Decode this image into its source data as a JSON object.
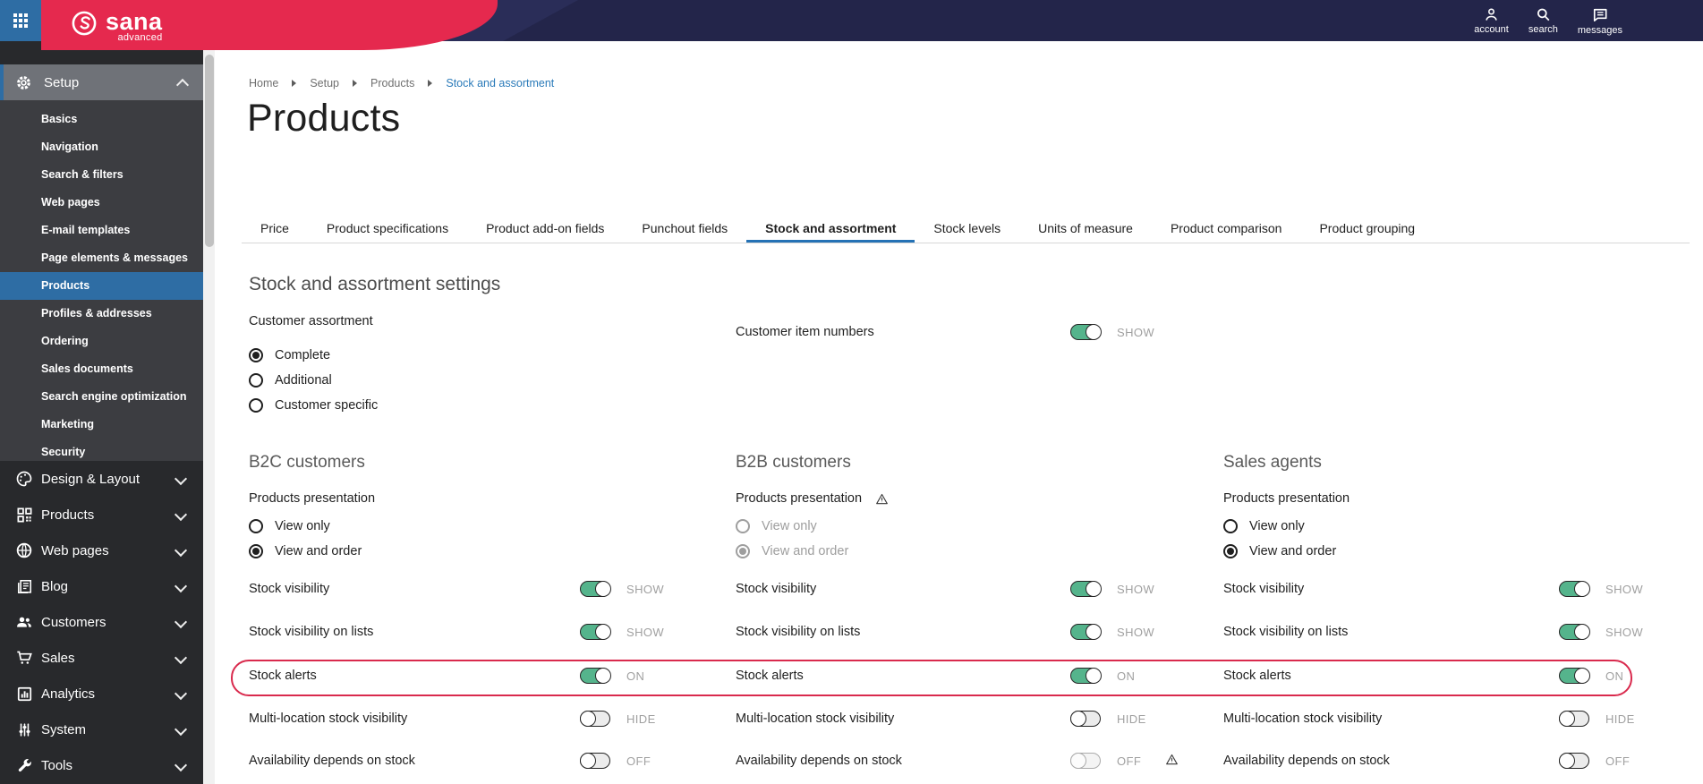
{
  "topbar": {
    "brand": "sana",
    "brand_sub": "advanced",
    "actions": [
      {
        "label": "account"
      },
      {
        "label": "search"
      },
      {
        "label": "messages"
      }
    ]
  },
  "sidebar": {
    "setup_label": "Setup",
    "setup_items": [
      "Basics",
      "Navigation",
      "Search & filters",
      "Web pages",
      "E-mail templates",
      "Page elements & messages",
      "Products",
      "Profiles & addresses",
      "Ordering",
      "Sales documents",
      "Search engine optimization",
      "Marketing",
      "Security"
    ],
    "active_item": "Products",
    "sections": [
      {
        "label": "Design & Layout"
      },
      {
        "label": "Products"
      },
      {
        "label": "Web pages"
      },
      {
        "label": "Blog"
      },
      {
        "label": "Customers"
      },
      {
        "label": "Sales"
      },
      {
        "label": "Analytics"
      },
      {
        "label": "System"
      },
      {
        "label": "Tools"
      }
    ]
  },
  "breadcrumb": {
    "items": [
      "Home",
      "Setup",
      "Products",
      "Stock and assortment"
    ]
  },
  "page": {
    "title": "Products"
  },
  "tabs": [
    "Price",
    "Product specifications",
    "Product add-on fields",
    "Punchout fields",
    "Stock and assortment",
    "Stock levels",
    "Units of measure",
    "Product comparison",
    "Product grouping"
  ],
  "active_tab": "Stock and assortment",
  "settings": {
    "heading": "Stock and assortment settings",
    "customer_assortment": {
      "label": "Customer assortment",
      "options": [
        "Complete",
        "Additional",
        "Customer specific"
      ],
      "selected": "Complete"
    },
    "customer_item_numbers": {
      "label": "Customer item numbers",
      "state": "SHOW"
    }
  },
  "columns": [
    {
      "heading": "B2C customers",
      "presentation": {
        "label": "Products presentation",
        "options": [
          "View only",
          "View and order"
        ],
        "selected": "View and order",
        "warning": false
      },
      "rows": [
        {
          "label": "Stock visibility",
          "state": "SHOW",
          "on": true
        },
        {
          "label": "Stock visibility on lists",
          "state": "SHOW",
          "on": true
        },
        {
          "label": "Stock alerts",
          "state": "ON",
          "on": true,
          "highlighted": true
        },
        {
          "label": "Multi-location stock visibility",
          "state": "HIDE",
          "on": false
        },
        {
          "label": "Availability depends on stock",
          "state": "OFF",
          "on": false
        }
      ]
    },
    {
      "heading": "B2B customers",
      "presentation": {
        "label": "Products presentation",
        "options": [
          "View only",
          "View and order"
        ],
        "selected": "View and order",
        "warning": true,
        "disabled": true
      },
      "rows": [
        {
          "label": "Stock visibility",
          "state": "SHOW",
          "on": true
        },
        {
          "label": "Stock visibility on lists",
          "state": "SHOW",
          "on": true
        },
        {
          "label": "Stock alerts",
          "state": "ON",
          "on": true,
          "highlighted": true
        },
        {
          "label": "Multi-location stock visibility",
          "state": "HIDE",
          "on": false
        },
        {
          "label": "Availability depends on stock",
          "state": "OFF",
          "on": false,
          "disabled": true,
          "warning": true
        }
      ]
    },
    {
      "heading": "Sales agents",
      "presentation": {
        "label": "Products presentation",
        "options": [
          "View only",
          "View and order"
        ],
        "selected": "View and order",
        "warning": false
      },
      "rows": [
        {
          "label": "Stock visibility",
          "state": "SHOW",
          "on": true
        },
        {
          "label": "Stock visibility on lists",
          "state": "SHOW",
          "on": true
        },
        {
          "label": "Stock alerts",
          "state": "ON",
          "on": true,
          "highlighted": true
        },
        {
          "label": "Multi-location stock visibility",
          "state": "HIDE",
          "on": false
        },
        {
          "label": "Availability depends on stock",
          "state": "OFF",
          "on": false
        }
      ]
    }
  ],
  "colors": {
    "topbar_navy": "#23254a",
    "brand_red": "#e5294e",
    "accent_blue": "#2e6da4",
    "tab_underline_blue": "#2572b5",
    "toggle_green": "#55b48c",
    "highlight_red": "#d92a4d"
  }
}
